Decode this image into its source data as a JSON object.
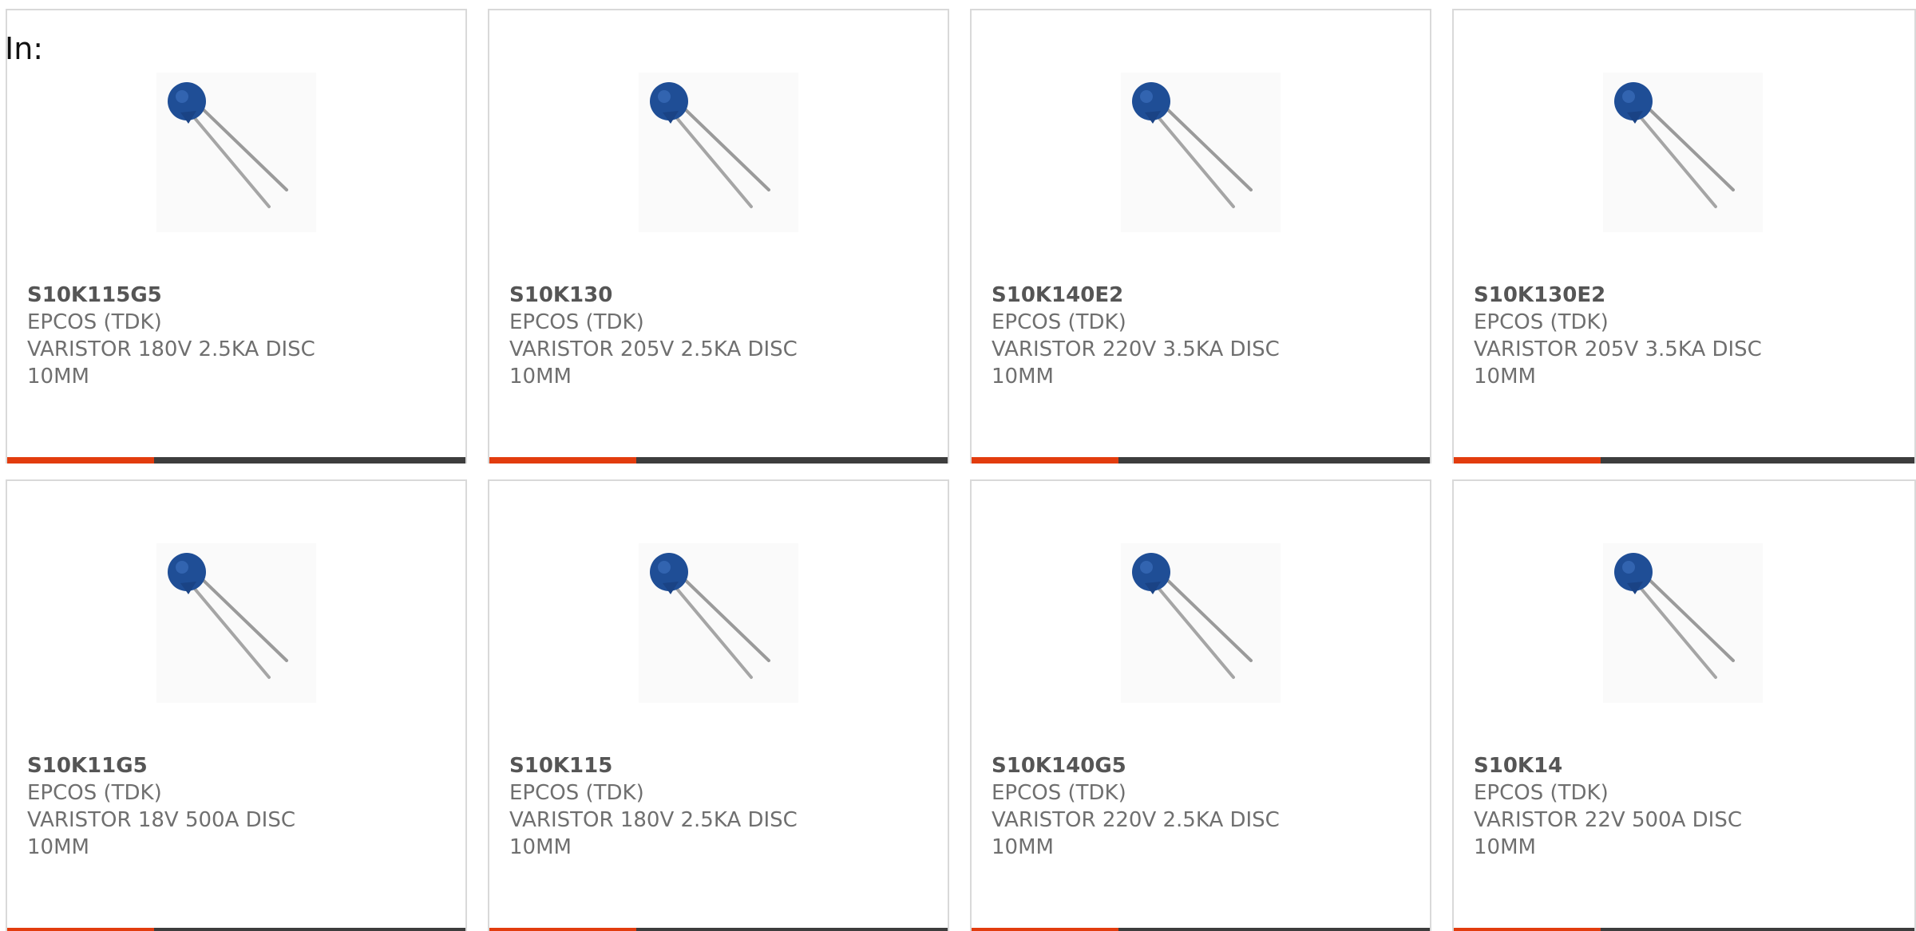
{
  "filter_label": "In:",
  "colors": {
    "accent": "#e23c0e",
    "bar": "#3d3d3d",
    "varistor_blue": "#1f4e96"
  },
  "products": [
    {
      "part_number": "S10K115G5",
      "manufacturer": "EPCOS (TDK)",
      "description": "VARISTOR 180V 2.5KA DISC 10MM",
      "image_icon": "varistor-image"
    },
    {
      "part_number": "S10K130",
      "manufacturer": "EPCOS (TDK)",
      "description": "VARISTOR 205V 2.5KA DISC 10MM",
      "image_icon": "varistor-image"
    },
    {
      "part_number": "S10K140E2",
      "manufacturer": "EPCOS (TDK)",
      "description": "VARISTOR 220V 3.5KA DISC 10MM",
      "image_icon": "varistor-image"
    },
    {
      "part_number": "S10K130E2",
      "manufacturer": "EPCOS (TDK)",
      "description": "VARISTOR 205V 3.5KA DISC 10MM",
      "image_icon": "varistor-image"
    },
    {
      "part_number": "S10K11G5",
      "manufacturer": "EPCOS (TDK)",
      "description": "VARISTOR 18V 500A DISC 10MM",
      "image_icon": "varistor-image"
    },
    {
      "part_number": "S10K115",
      "manufacturer": "EPCOS (TDK)",
      "description": "VARISTOR 180V 2.5KA DISC 10MM",
      "image_icon": "varistor-image"
    },
    {
      "part_number": "S10K140G5",
      "manufacturer": "EPCOS (TDK)",
      "description": "VARISTOR 220V 2.5KA DISC 10MM",
      "image_icon": "varistor-image"
    },
    {
      "part_number": "S10K14",
      "manufacturer": "EPCOS (TDK)",
      "description": "VARISTOR 22V 500A DISC 10MM",
      "image_icon": "varistor-image"
    }
  ]
}
